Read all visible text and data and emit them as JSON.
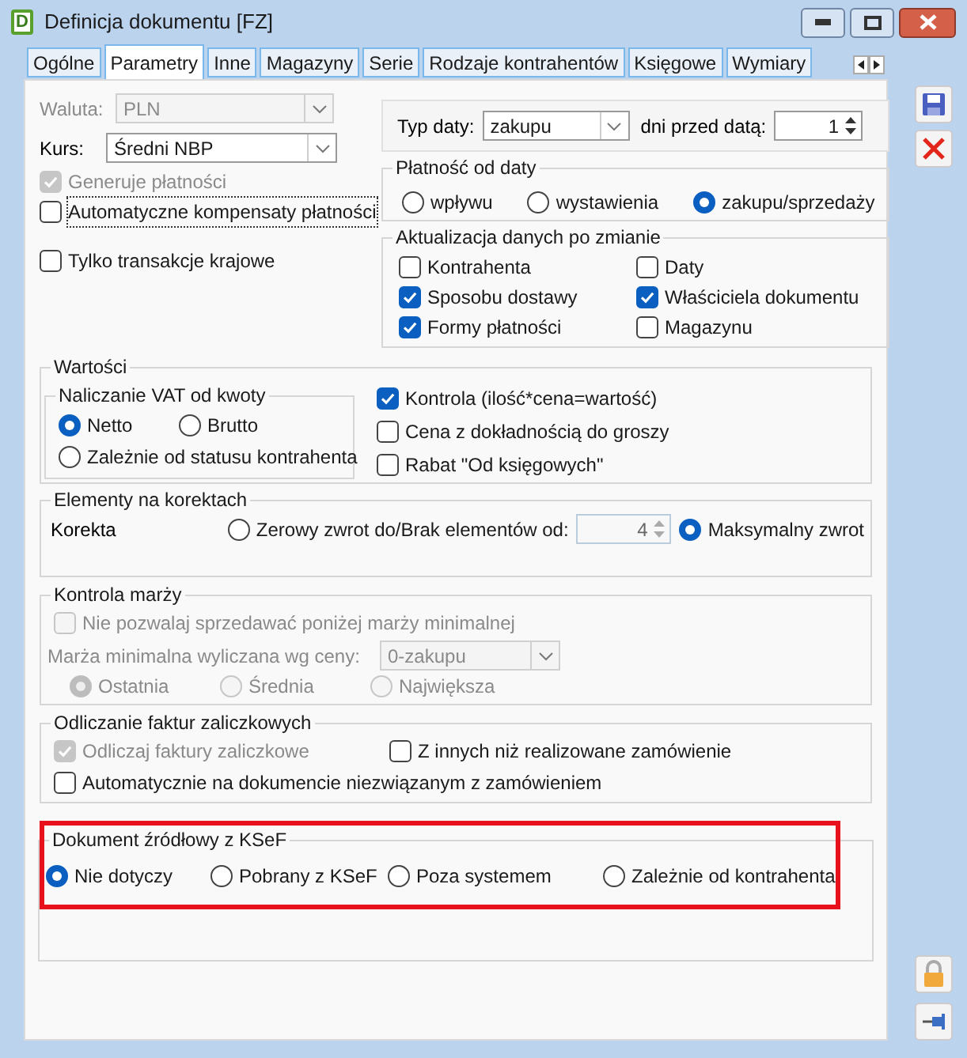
{
  "window": {
    "title": "Definicja dokumentu [FZ]",
    "app_icon": "D"
  },
  "tabs": [
    {
      "label": "Ogólne",
      "selected": false
    },
    {
      "label": "Parametry",
      "selected": true
    },
    {
      "label": "Inne",
      "selected": false
    },
    {
      "label": "Magazyny",
      "selected": false
    },
    {
      "label": "Serie",
      "selected": false
    },
    {
      "label": "Rodzaje kontrahentów",
      "selected": false
    },
    {
      "label": "Księgowe",
      "selected": false
    },
    {
      "label": "Wymiary",
      "selected": false
    }
  ],
  "waluta": {
    "label": "Waluta:",
    "value": "PLN",
    "disabled": true
  },
  "kurs": {
    "label": "Kurs:",
    "value": "Średni NBP",
    "disabled": false
  },
  "left_checkboxes": [
    {
      "label": "Generuje płatności",
      "checked": true,
      "disabled": true,
      "focused": false
    },
    {
      "label": "Automatyczne kompensaty płatności",
      "checked": false,
      "disabled": false,
      "focused": true
    },
    {
      "label": "Tylko transakcje krajowe",
      "checked": false,
      "disabled": false,
      "focused": false
    }
  ],
  "typ_daty": {
    "label": "Typ daty:",
    "value": "zakupu",
    "days_label": "dni przed datą:",
    "days": "1"
  },
  "platnosc_od_daty": {
    "title": "Płatność od daty",
    "options": [
      {
        "label": "wpływu",
        "selected": false
      },
      {
        "label": "wystawienia",
        "selected": false
      },
      {
        "label": "zakupu/sprzedaży",
        "selected": true
      }
    ]
  },
  "aktualizacja": {
    "title": "Aktualizacja danych po zmianie",
    "items": [
      {
        "label": "Kontrahenta",
        "checked": false
      },
      {
        "label": "Daty",
        "checked": false
      },
      {
        "label": "Sposobu dostawy",
        "checked": true
      },
      {
        "label": "Właściciela dokumentu",
        "checked": true
      },
      {
        "label": "Formy płatności",
        "checked": true
      },
      {
        "label": "Magazynu",
        "checked": false
      }
    ]
  },
  "wartosci": {
    "title": "Wartości",
    "vat": {
      "title": "Naliczanie VAT od kwoty",
      "options": [
        {
          "label": "Netto",
          "selected": true
        },
        {
          "label": "Brutto",
          "selected": false
        },
        {
          "label": "Zależnie od statusu kontrahenta",
          "selected": false
        }
      ]
    },
    "checkboxes": [
      {
        "label": "Kontrola (ilość*cena=wartość)",
        "checked": true
      },
      {
        "label": "Cena z dokładnością do groszy",
        "checked": false
      },
      {
        "label": "Rabat \"Od księgowych\"",
        "checked": false
      }
    ]
  },
  "korekty": {
    "title": "Elementy na korektach",
    "label": "Korekta",
    "options": [
      {
        "label": "Zerowy zwrot do/Brak elementów od:",
        "selected": false
      },
      {
        "label": "Maksymalny zwrot",
        "selected": true
      }
    ],
    "spinner": {
      "value": "4",
      "disabled": true
    }
  },
  "kontrola_marzy": {
    "title": "Kontrola marży",
    "checkbox": {
      "label": "Nie pozwalaj sprzedawać poniżej marży minimalnej",
      "checked": false,
      "disabled": true
    },
    "price_label": "Marża minimalna wyliczana wg ceny:",
    "select": {
      "value": "0-zakupu",
      "disabled": true
    },
    "options": [
      {
        "label": "Ostatnia",
        "selected": true,
        "disabled": true
      },
      {
        "label": "Średnia",
        "selected": false,
        "disabled": true
      },
      {
        "label": "Największa",
        "selected": false,
        "disabled": true
      }
    ]
  },
  "odliczanie": {
    "title": "Odliczanie faktur zaliczkowych",
    "checkboxes": [
      {
        "label": "Odliczaj faktury zaliczkowe",
        "checked": true,
        "disabled": true
      },
      {
        "label": "Z innych niż realizowane zamówienie",
        "checked": false,
        "disabled": false
      },
      {
        "label": "Automatycznie na dokumencie niezwiązanym z zamówieniem",
        "checked": false,
        "disabled": false
      }
    ]
  },
  "ksef": {
    "title": "Dokument źródłowy z KSeF",
    "highlighted": true,
    "options": [
      {
        "label": "Nie dotyczy",
        "selected": true
      },
      {
        "label": "Pobrany z KSeF",
        "selected": false
      },
      {
        "label": "Poza systemem",
        "selected": false
      },
      {
        "label": "Zależnie od kontrahenta",
        "selected": false
      }
    ]
  }
}
